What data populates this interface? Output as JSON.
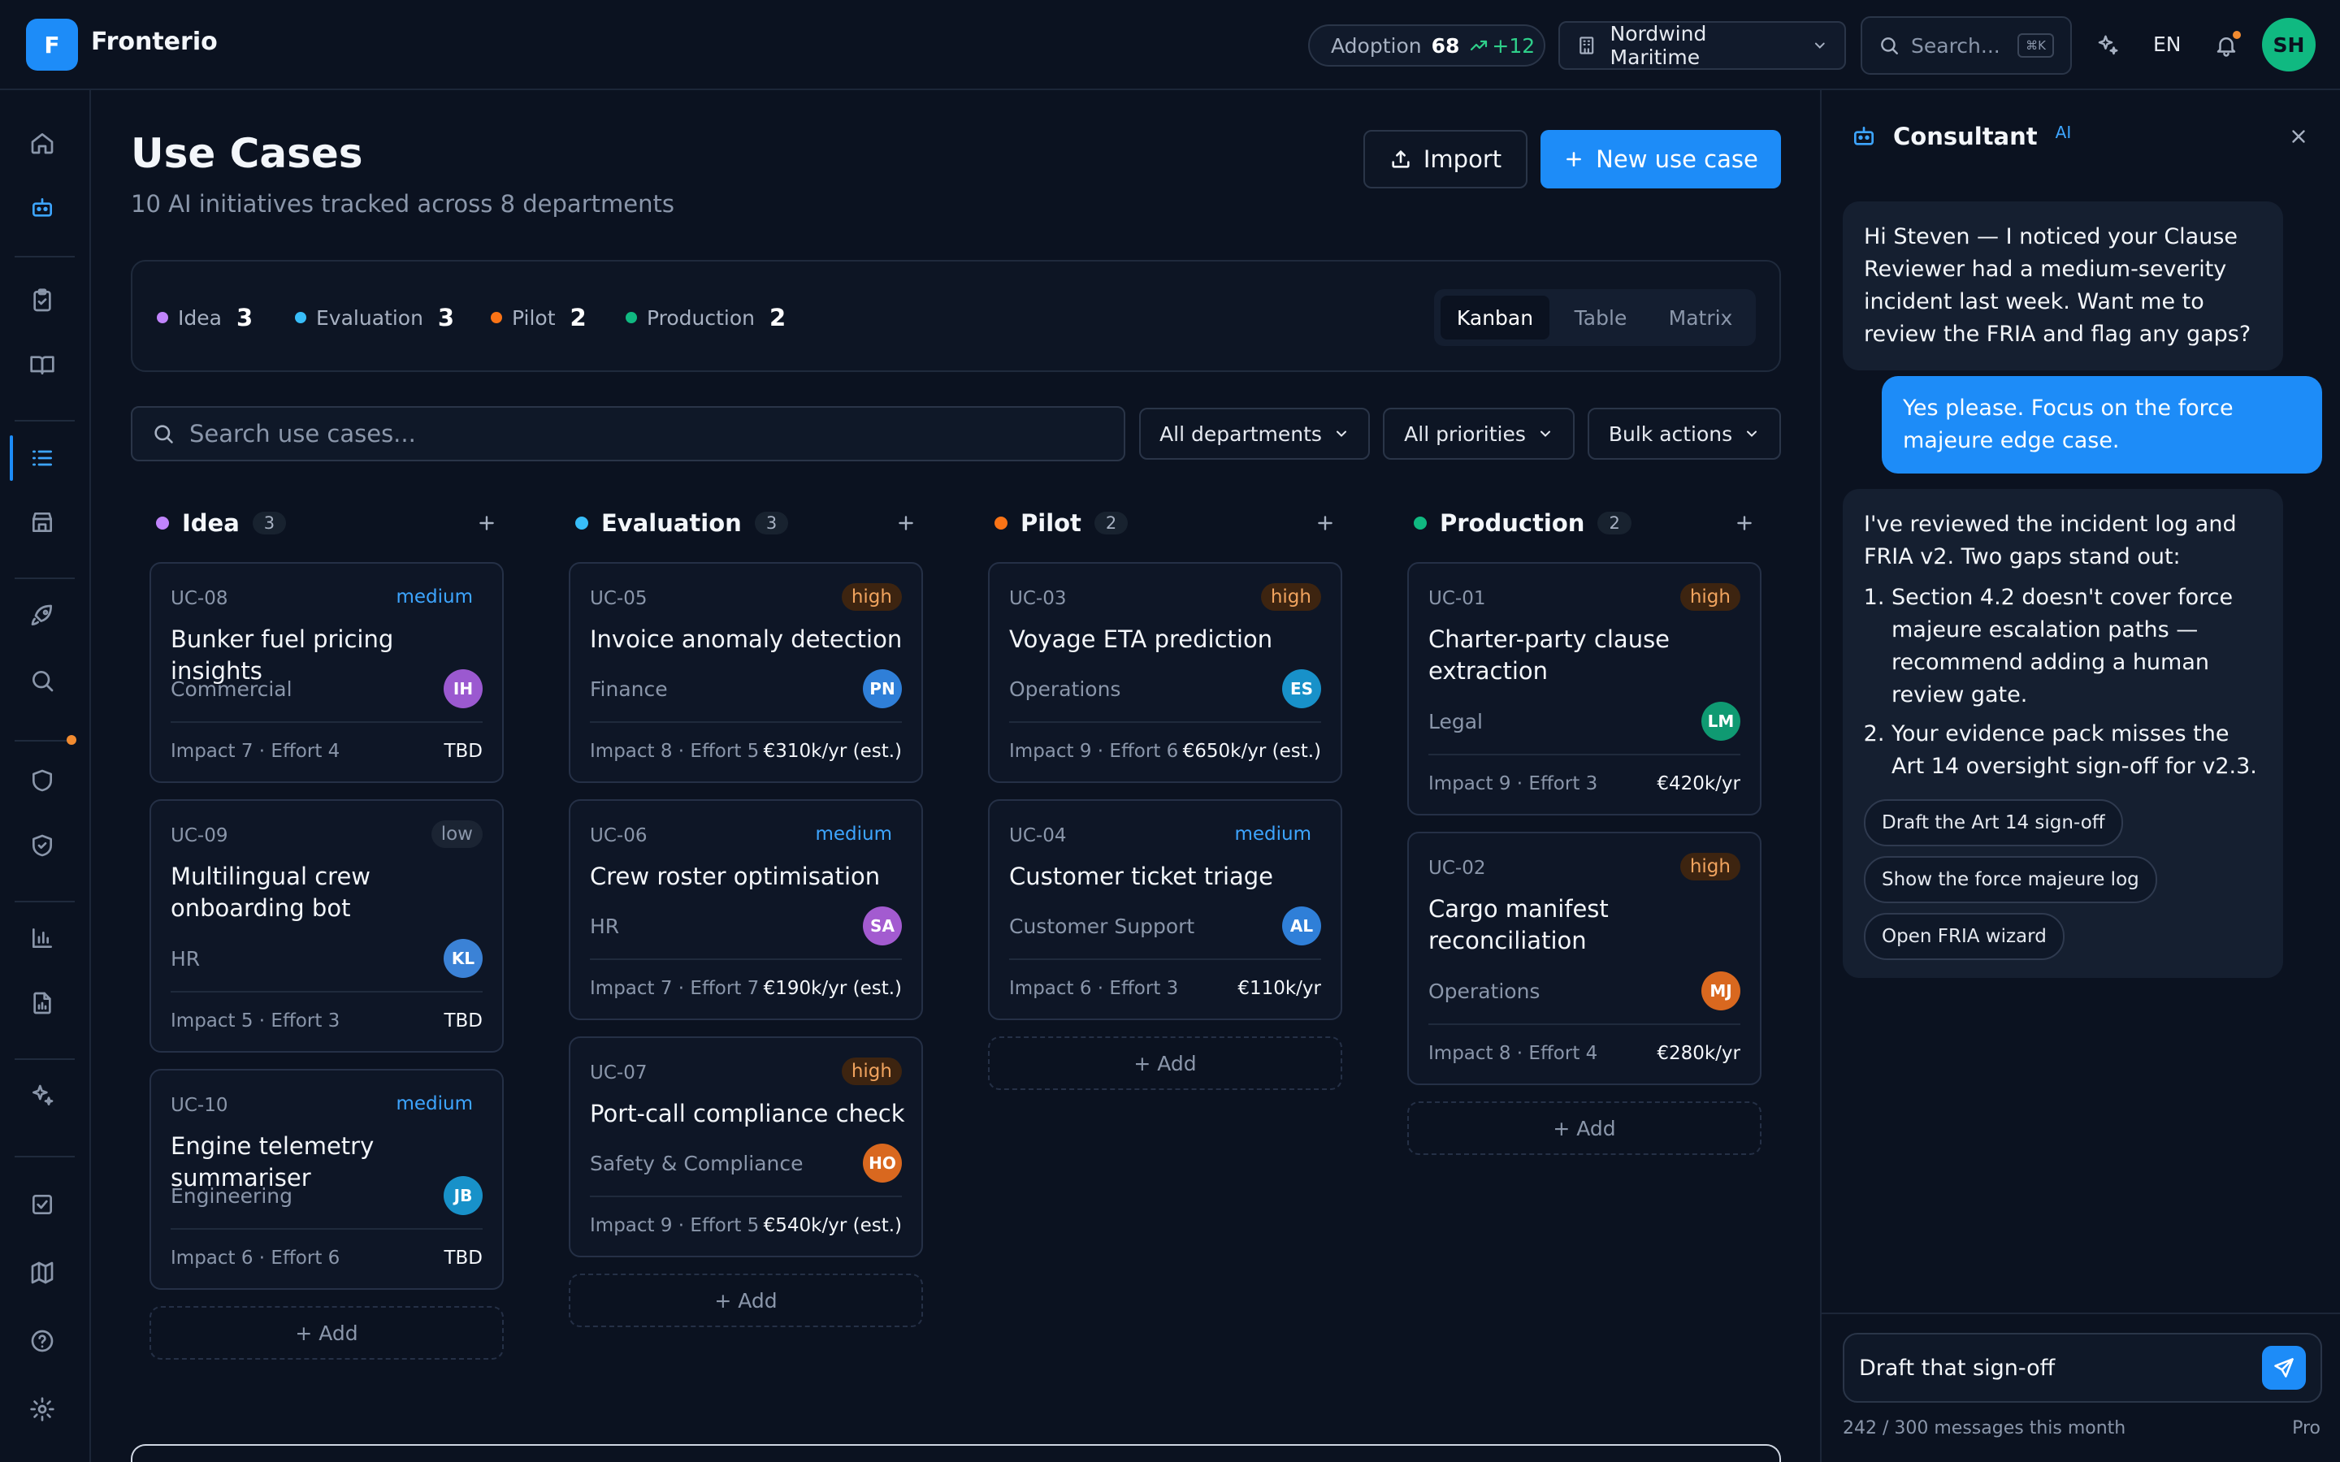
{
  "app": {
    "logo_letter": "F",
    "brand": "Fronterio",
    "accent": "#1d8cf8"
  },
  "topbar": {
    "adoption_label": "Adoption",
    "adoption_value": "68",
    "adoption_delta": "+12",
    "org": "Nordwind Maritime",
    "search_placeholder": "Search...",
    "search_shortcut": "⌘K",
    "language": "EN",
    "user_initials": "SH"
  },
  "page": {
    "title": "Use Cases",
    "subtitle": "10 AI initiatives tracked across 8 departments",
    "import_label": "Import",
    "new_label": "New use case"
  },
  "stages": [
    {
      "name": "Idea",
      "count": "3",
      "color": "#c084fc"
    },
    {
      "name": "Evaluation",
      "count": "3",
      "color": "#38bdf8"
    },
    {
      "name": "Pilot",
      "count": "2",
      "color": "#f97316"
    },
    {
      "name": "Production",
      "count": "2",
      "color": "#10b981"
    }
  ],
  "views": [
    "Kanban",
    "Table",
    "Matrix"
  ],
  "active_view": "Kanban",
  "filters": {
    "search_placeholder": "Search use cases...",
    "departments": "All departments",
    "priorities": "All priorities",
    "bulk": "Bulk actions"
  },
  "add_label": "+ Add",
  "columns": [
    {
      "name": "Idea",
      "count": "3",
      "color": "#c084fc",
      "cards": [
        {
          "id": "UC-08",
          "priority": "medium",
          "title": "Bunker fuel pricing insights",
          "dept": "Commercial",
          "owner": "IH",
          "owner_color": "#9b59d0",
          "metrics": "Impact 7 · Effort 4",
          "value": "TBD"
        },
        {
          "id": "UC-09",
          "priority": "low",
          "title": "Multilingual crew onboarding bot",
          "dept": "HR",
          "owner": "KL",
          "owner_color": "#3b82d6",
          "metrics": "Impact 5 · Effort 3",
          "value": "TBD"
        },
        {
          "id": "UC-10",
          "priority": "medium",
          "title": "Engine telemetry summariser",
          "dept": "Engineering",
          "owner": "JB",
          "owner_color": "#1891c9",
          "metrics": "Impact 6 · Effort 6",
          "value": "TBD"
        }
      ]
    },
    {
      "name": "Evaluation",
      "count": "3",
      "color": "#38bdf8",
      "cards": [
        {
          "id": "UC-05",
          "priority": "high",
          "title": "Invoice anomaly detection",
          "dept": "Finance",
          "owner": "PN",
          "owner_color": "#2f7fd8",
          "metrics": "Impact 8 · Effort 5",
          "value": "€310k/yr (est.)"
        },
        {
          "id": "UC-06",
          "priority": "medium",
          "title": "Crew roster optimisation",
          "dept": "HR",
          "owner": "SA",
          "owner_color": "#a35bd0",
          "metrics": "Impact 7 · Effort 7",
          "value": "€190k/yr (est.)"
        },
        {
          "id": "UC-07",
          "priority": "high",
          "title": "Port-call compliance check",
          "dept": "Safety & Compliance",
          "owner": "HO",
          "owner_color": "#d9681f",
          "metrics": "Impact 9 · Effort 5",
          "value": "€540k/yr (est.)"
        }
      ]
    },
    {
      "name": "Pilot",
      "count": "2",
      "color": "#f97316",
      "cards": [
        {
          "id": "UC-03",
          "priority": "high",
          "title": "Voyage ETA prediction",
          "dept": "Operations",
          "owner": "ES",
          "owner_color": "#1891c9",
          "metrics": "Impact 9 · Effort 6",
          "value": "€650k/yr (est.)"
        },
        {
          "id": "UC-04",
          "priority": "medium",
          "title": "Customer ticket triage",
          "dept": "Customer Support",
          "owner": "AL",
          "owner_color": "#2f7fd8",
          "metrics": "Impact 6 · Effort 3",
          "value": "€110k/yr"
        }
      ]
    },
    {
      "name": "Production",
      "count": "2",
      "color": "#10b981",
      "cards": [
        {
          "id": "UC-01",
          "priority": "high",
          "title": "Charter-party clause extraction",
          "dept": "Legal",
          "owner": "LM",
          "owner_color": "#0f9a72",
          "metrics": "Impact 9 · Effort 3",
          "value": "€420k/yr"
        },
        {
          "id": "UC-02",
          "priority": "high",
          "title": "Cargo manifest reconciliation",
          "dept": "Operations",
          "owner": "MJ",
          "owner_color": "#d9681f",
          "metrics": "Impact 8 · Effort 4",
          "value": "€280k/yr"
        }
      ]
    }
  ],
  "consultant": {
    "title": "Consultant",
    "badge": "AI",
    "msg1": "Hi Steven — I noticed your Clause Reviewer had a medium-severity incident last week. Want me to review the FRIA and flag any gaps?",
    "msg2": "Yes please. Focus on the force majeure edge case.",
    "msg3_intro": "I've reviewed the incident log and FRIA v2. Two gaps stand out:",
    "msg3_points": [
      "Section 4.2 doesn't cover force majeure escalation paths — recommend adding a human review gate.",
      "Your evidence pack misses the Art 14 oversight sign-off for v2.3."
    ],
    "chips": [
      "Draft the Art 14 sign-off",
      "Show the force majeure log",
      "Open FRIA wizard"
    ],
    "input_value": "Draft that sign-off",
    "quota": "242 / 300 messages this month",
    "plan": "Pro"
  }
}
